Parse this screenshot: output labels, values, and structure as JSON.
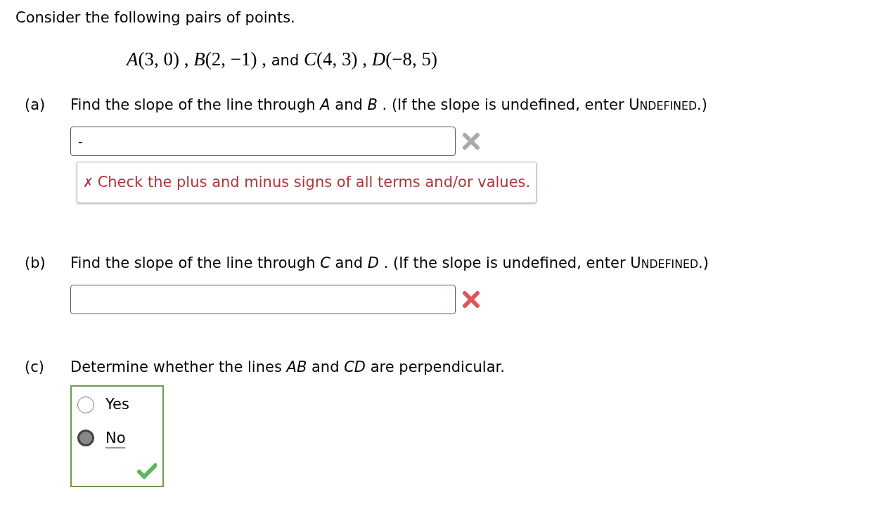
{
  "intro": "Consider the following pairs of points.",
  "points": "*A*(3, 0) , *B*(2, −1) , and *C*(4, 3) , *D*(−8, 5)",
  "parts": [
    {
      "kind": "text",
      "label": "(a)",
      "question": "Find the slope of the line through *A* and *B* . (If the slope is undefined, enter ",
      "keyword": "UNDEFINED",
      "tail": ".)",
      "value": "-",
      "correct": false,
      "stale": true,
      "feedback": "Check the plus and minus signs of all terms and/or values.",
      "feedback_mark": "✗"
    },
    {
      "kind": "text",
      "label": "(b)",
      "question": "Find the slope of the line through *C* and *D* . (If the slope is undefined, enter ",
      "keyword": "UNDEFINED",
      "tail": ".)",
      "correct": false,
      "stale": false
    },
    {
      "kind": "radio",
      "label": "(c)",
      "question": "Determine whether the lines *AB* and *CD* are perpendicular.",
      "correct": true,
      "options": [
        {
          "label": "Yes",
          "selected": false
        },
        {
          "label": "No",
          "selected": true
        }
      ]
    }
  ]
}
